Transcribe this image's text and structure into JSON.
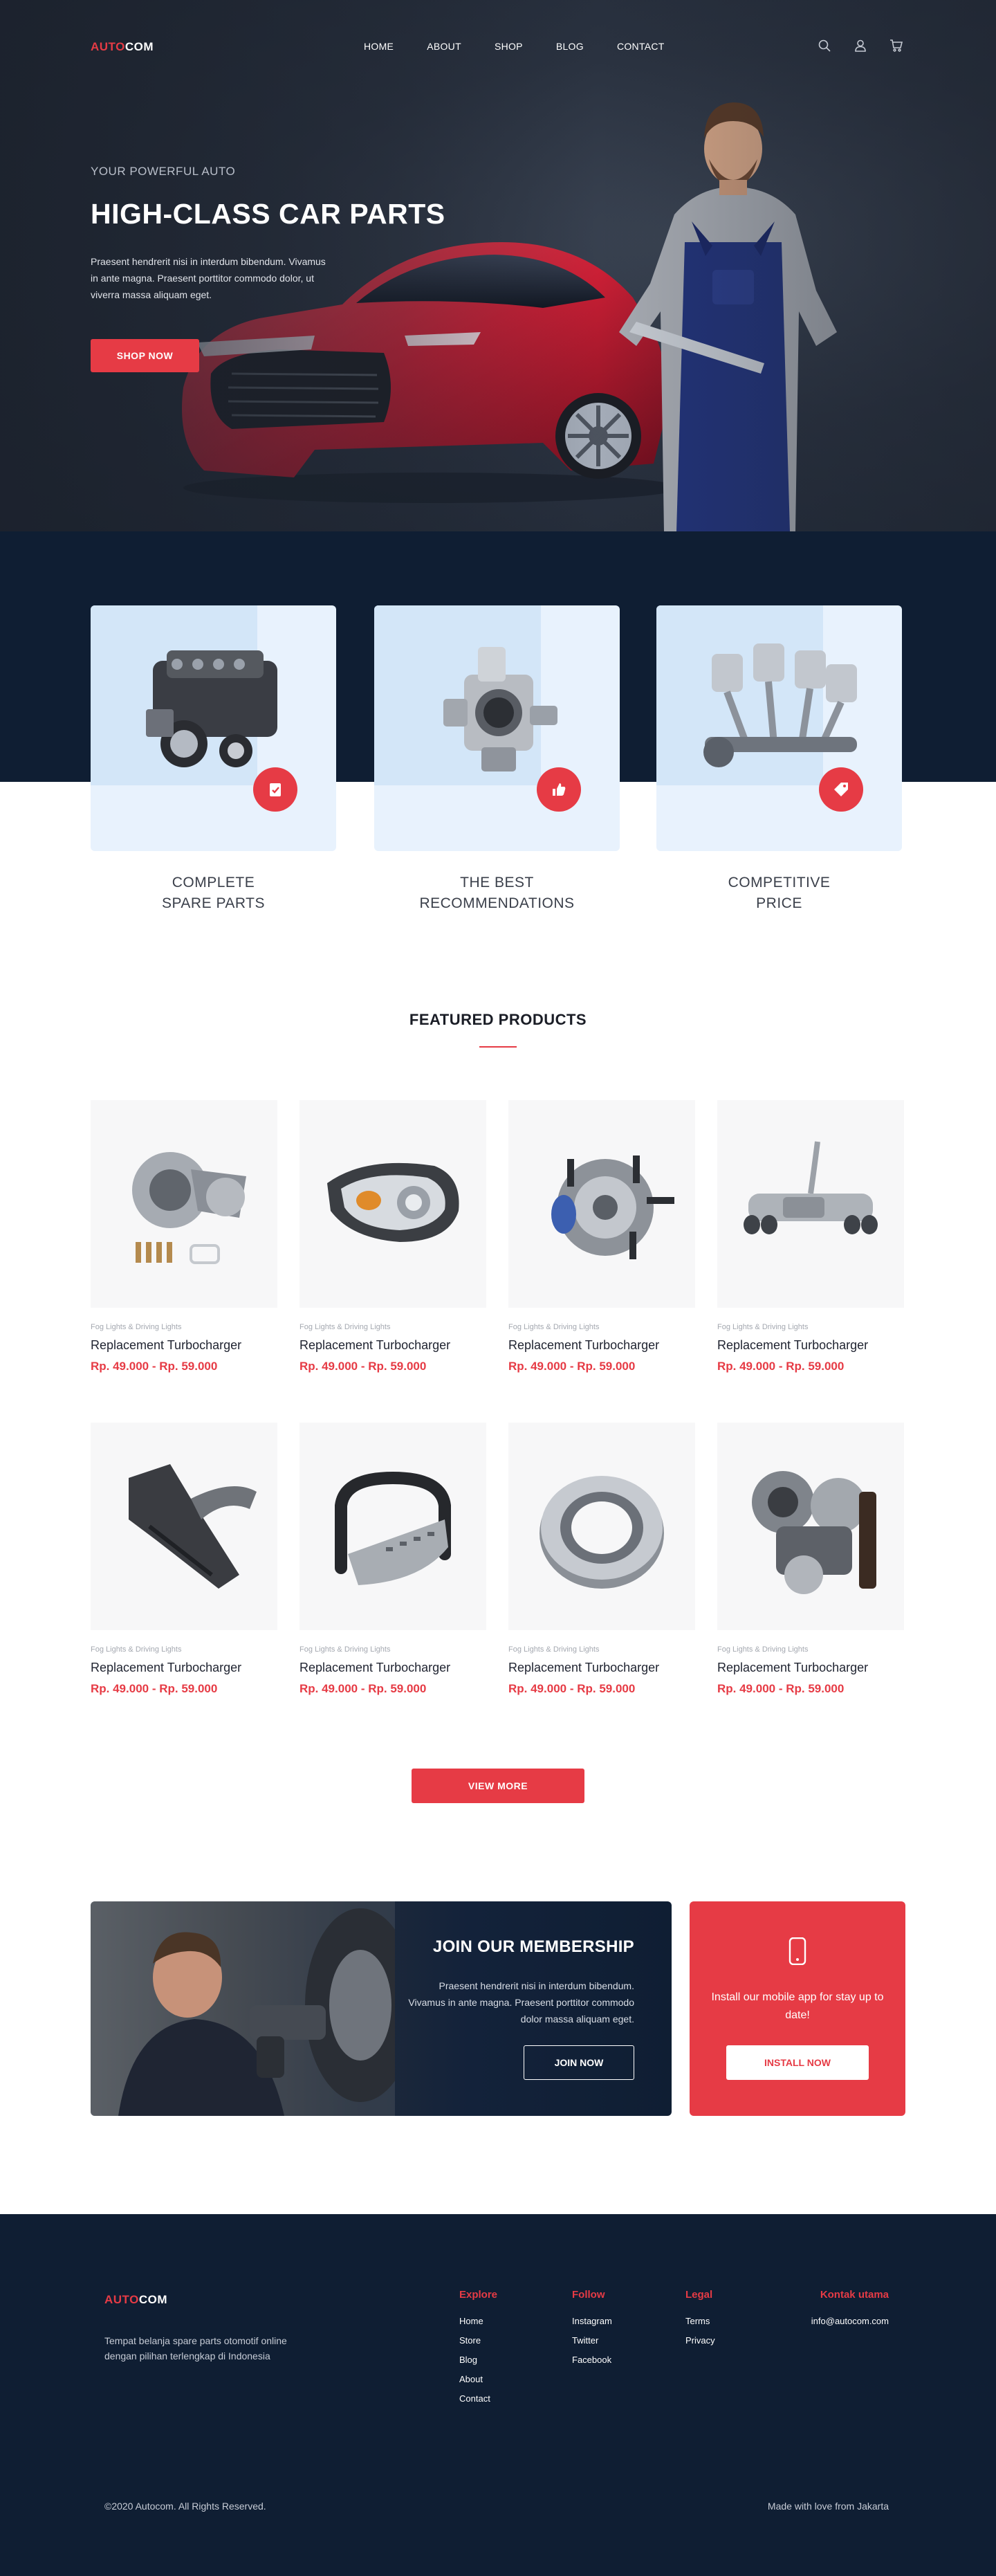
{
  "brand": {
    "logo_part1": "AUTO",
    "logo_part2": "COM"
  },
  "nav": {
    "items": [
      "HOME",
      "ABOUT",
      "SHOP",
      "BLOG",
      "CONTACT"
    ],
    "icons": [
      "search-icon",
      "user-icon",
      "cart-icon"
    ]
  },
  "hero": {
    "subtitle": "YOUR POWERFUL AUTO",
    "title": "HIGH-CLASS CAR PARTS",
    "description": "Praesent hendrerit nisi in interdum bibendum. Vivamus in ante magna. Praesent porttitor commodo dolor, ut viverra massa aliquam eget.",
    "cta": "SHOP NOW"
  },
  "features": [
    {
      "line1": "COMPLETE",
      "line2": "SPARE PARTS",
      "icon": "check-clipboard-icon"
    },
    {
      "line1": "THE BEST",
      "line2": "RECOMMENDATIONS",
      "icon": "thumbs-up-icon"
    },
    {
      "line1": "COMPETITIVE",
      "line2": "PRICE",
      "icon": "price-tag-icon"
    }
  ],
  "products_section": {
    "title": "FEATURED PRODUCTS",
    "items": [
      {
        "category": "Fog Lights & Driving Lights",
        "name": "Replacement Turbocharger",
        "price": "Rp. 49.000 - Rp. 59.000",
        "image": "turbocharger"
      },
      {
        "category": "Fog Lights & Driving Lights",
        "name": "Replacement Turbocharger",
        "price": "Rp. 49.000 - Rp. 59.000",
        "image": "headlight"
      },
      {
        "category": "Fog Lights & Driving Lights",
        "name": "Replacement Turbocharger",
        "price": "Rp. 49.000 - Rp. 59.000",
        "image": "wheel-hub"
      },
      {
        "category": "Fog Lights & Driving Lights",
        "name": "Replacement Turbocharger",
        "price": "Rp. 49.000 - Rp. 59.000",
        "image": "exhaust"
      },
      {
        "category": "Fog Lights & Driving Lights",
        "name": "Replacement Turbocharger",
        "price": "Rp. 49.000 - Rp. 59.000",
        "image": "air-intake"
      },
      {
        "category": "Fog Lights & Driving Lights",
        "name": "Replacement Turbocharger",
        "price": "Rp. 49.000 - Rp. 59.000",
        "image": "bull-bar"
      },
      {
        "category": "Fog Lights & Driving Lights",
        "name": "Replacement Turbocharger",
        "price": "Rp. 49.000 - Rp. 59.000",
        "image": "wheel-bearing"
      },
      {
        "category": "Fog Lights & Driving Lights",
        "name": "Replacement Turbocharger",
        "price": "Rp. 49.000 - Rp. 59.000",
        "image": "turbo-assembly"
      }
    ],
    "view_more": "VIEW MORE"
  },
  "membership": {
    "title": "JOIN OUR MEMBERSHIP",
    "description": "Praesent hendrerit nisi in interdum bibendum. Vivamus in ante magna. Praesent porttitor commodo dolor massa aliquam eget.",
    "cta": "JOIN NOW"
  },
  "app_promo": {
    "icon": "phone-icon",
    "text": "Install our mobile app for stay up to date!",
    "cta": "INSTALL NOW"
  },
  "footer": {
    "description": "Tempat belanja spare parts otomotif online dengan pilihan terlengkap di Indonesia",
    "explore": {
      "title": "Explore",
      "links": [
        "Home",
        "Store",
        "Blog",
        "About",
        "Contact"
      ]
    },
    "follow": {
      "title": "Follow",
      "links": [
        "Instagram",
        "Twitter",
        "Facebook"
      ]
    },
    "legal": {
      "title": "Legal",
      "links": [
        "Terms",
        "Privacy"
      ]
    },
    "contact": {
      "title": "Kontak utama",
      "email": "info@autocom.com"
    },
    "copyright": "©2020 Autocom. All Rights Reserved.",
    "made_with": "Made with love from Jakarta"
  },
  "colors": {
    "accent": "#e63b45",
    "navy": "#0f1e33",
    "card_light": "#e8f2fd",
    "card_mid": "#d3e6f8"
  }
}
